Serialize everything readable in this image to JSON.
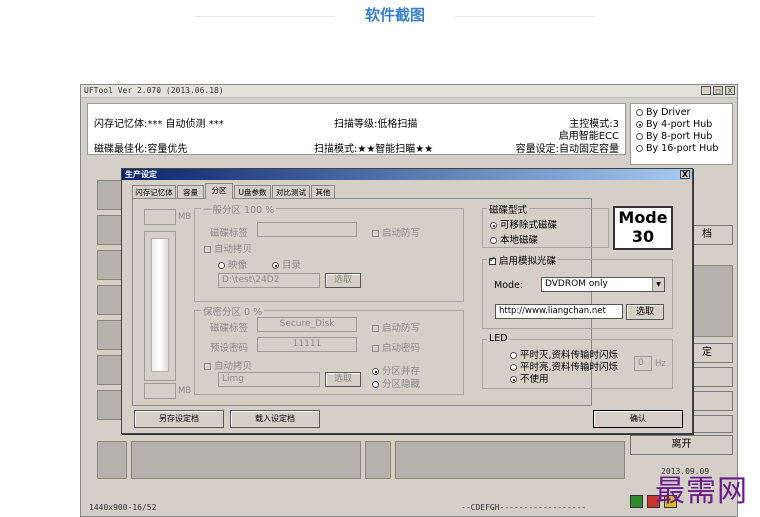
{
  "page": {
    "heading": "软件截图"
  },
  "app": {
    "title": "UFTool Ver 2.070 (2013.06.18)",
    "window_buttons": [
      "_",
      "□",
      "X"
    ],
    "info": {
      "flash": "闪存记忆体:*** 自动侦测 ***",
      "scan_level": "扫描等级:低格扫描",
      "master_mode": "主控模式:3",
      "ecc": "启用智能ECC",
      "optimize": "磁碟最佳化:容量优先",
      "scan_mode": "扫描模式:★★智能扫瞄★★",
      "capacity": "容量设定:自动固定容量"
    },
    "driver_options": [
      {
        "label": "By Driver",
        "selected": false
      },
      {
        "label": "By 4-port Hub",
        "selected": true
      },
      {
        "label": "By 8-port Hub",
        "selected": false
      },
      {
        "label": "By 16-port Hub",
        "selected": false
      }
    ],
    "right_buttons": {
      "doc": "档",
      "set": "定",
      "leave": "离开"
    },
    "date_partial": "2013.09.09",
    "status_left": "1440x900-16/52",
    "status_mid": "--CDEFGH------------------"
  },
  "dialog": {
    "title": "生产设定",
    "close": "X",
    "tabs": [
      "闪存记忆体",
      "容量",
      "分区",
      "U盘参数",
      "对比测试",
      "其他"
    ],
    "active_tab": 2,
    "mb1": "MB",
    "mb2": "MB",
    "general": {
      "title": "一般分区  100 %",
      "label_label": "磁碟标签",
      "write_protect": "启动防写",
      "auto_copy": "自动拷贝",
      "image": "映像",
      "folder": "目录",
      "path": "D:\\test\\24D2",
      "select": "选取"
    },
    "secure": {
      "title": "保密分区  0 %",
      "label_label": "磁碟标签",
      "label_value": "Secure_Disk",
      "write_protect": "启动防写",
      "password_label": "预设密码",
      "password_value": "11111",
      "start_password": "启动密码",
      "auto_copy": "自动拷贝",
      "path": "Limg",
      "select": "选取",
      "coexist": "分区并存",
      "hide": "分区隐藏"
    },
    "disk_type": {
      "title": "磁碟型式",
      "removable": "可移除式磁碟",
      "local": "本地磁碟"
    },
    "mode_badge": {
      "line1": "Mode",
      "line2": "30"
    },
    "cdrom": {
      "title": "启用模拟光碟",
      "mode_label": "Mode:",
      "mode_value": "DVDROM only",
      "url": "http://www.liangchan.net",
      "select": "选取"
    },
    "led": {
      "title": "LED",
      "opt1": "平时灭,资料传输时闪烁",
      "opt2": "平时亮,资料传输时闪烁",
      "opt3": "不使用",
      "value": "0",
      "unit": "Hz"
    },
    "buttons": {
      "save": "另存设定档",
      "load": "载入设定档",
      "ok": "确认"
    }
  },
  "watermark": "最需网"
}
